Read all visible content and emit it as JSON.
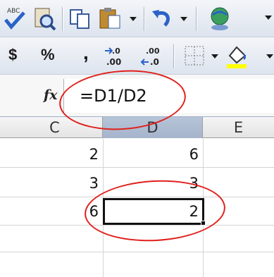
{
  "toolbar_standard": {
    "items": [
      "spelling-icon",
      "research-icon",
      "copy-icon",
      "paste-icon",
      "undo-icon",
      "hyperlink-icon"
    ]
  },
  "toolbar_formatting": {
    "currency_label": "$",
    "percent_label": "%",
    "comma_label": ",",
    "increase_decimal_label": ".00",
    "decrease_decimal_label": ".00"
  },
  "formula_bar": {
    "fx_label": "fx",
    "formula": "=D1/D2"
  },
  "columns": [
    "C",
    "D",
    "E"
  ],
  "rows": [
    {
      "c": "2",
      "d": "6"
    },
    {
      "c": "3",
      "d": "3"
    },
    {
      "c": "6",
      "d": "2"
    }
  ],
  "colors": {
    "annotation": "#e0201c",
    "selected_column_header": "#a5b4cb"
  }
}
